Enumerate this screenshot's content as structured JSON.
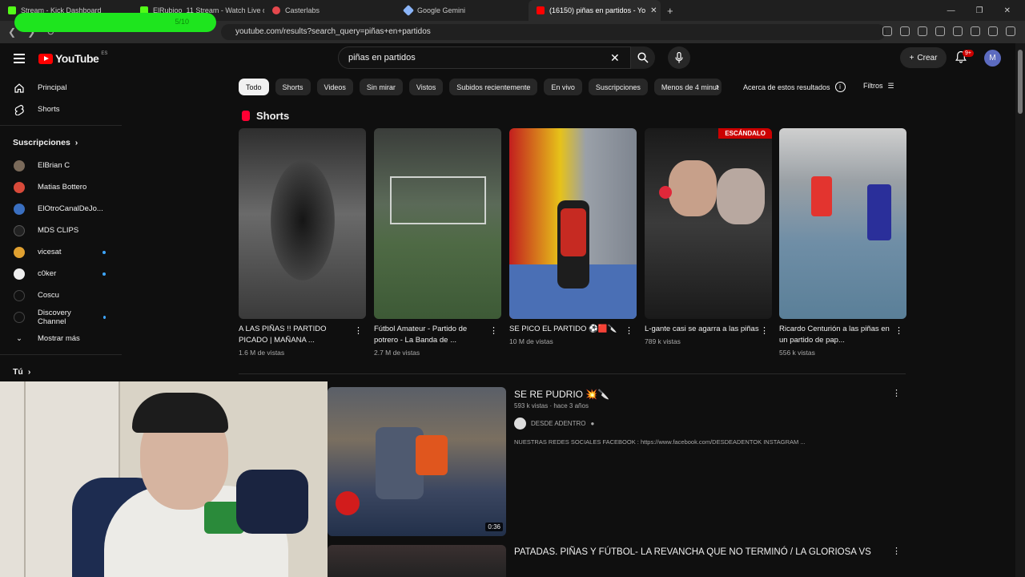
{
  "browser": {
    "tabs": [
      {
        "label": "Stream - Kick Dashboard",
        "color": "#53fc18"
      },
      {
        "label": "ElRubioo_11 Stream - Watch Live on",
        "color": "#53fc18"
      },
      {
        "label": "Casterlabs",
        "color": "#e5484d"
      },
      {
        "label": "Google Gemini",
        "color": "#8ab4f8"
      },
      {
        "label": "(16150) piñas en partidos - Yo",
        "color": "#ff0000"
      }
    ],
    "url": "youtube.com/results?search_query=piñas+en+partidos",
    "progress_text": "5/10",
    "progress_value": 0.5
  },
  "header": {
    "logo_text": "YouTube",
    "logo_country": "ES",
    "search_value": "piñas en partidos",
    "create_label": "Crear",
    "notif_count": "9+",
    "avatar_letter": "M"
  },
  "sidebar": {
    "main": [
      {
        "label": "Principal",
        "icon": "home-icon"
      },
      {
        "label": "Shorts",
        "icon": "shorts-icon"
      }
    ],
    "subs_title": "Suscripciones",
    "subs": [
      {
        "label": "ElBrian C",
        "color": "#7a6a5a",
        "dot": false
      },
      {
        "label": "Matias Bottero",
        "color": "#d84a3a",
        "dot": false
      },
      {
        "label": "ElOtroCanalDeJo...",
        "color": "#3a6fc0",
        "dot": true
      },
      {
        "label": "MDS CLIPS",
        "color": "#222",
        "dot": false
      },
      {
        "label": "vicesat",
        "color": "#e0a030",
        "dot": true
      },
      {
        "label": "c0ker",
        "color": "#eeeeee",
        "dot": true
      },
      {
        "label": "Coscu",
        "color": "#111",
        "dot": false
      },
      {
        "label": "Discovery Channel",
        "color": "#111",
        "dot": true
      }
    ],
    "show_more": "Mostrar más",
    "you": "Tú"
  },
  "chips": [
    "Todo",
    "Shorts",
    "Videos",
    "Sin mirar",
    "Vistos",
    "Subidos recientemente",
    "En vivo",
    "Suscripciones",
    "Menos de 4 minut"
  ],
  "about_label": "Acerca de estos resultados",
  "filters_label": "Filtros",
  "shorts_section": {
    "title": "Shorts",
    "items": [
      {
        "title": "A LAS PIÑAS !! PARTIDO PICADO | MAÑANA ...",
        "views": "1.6 M de vistas"
      },
      {
        "title": "Fútbol Amateur - Partido de potrero - La Banda de ...",
        "views": "2.7 M de vistas"
      },
      {
        "title": "SE PICO EL PARTIDO ⚽🟥🔪",
        "views": "10 M de vistas"
      },
      {
        "title": "L-gante casi se agarra a las piñas",
        "views": "789 k vistas",
        "badge": "ESCÁNDALO"
      },
      {
        "title": "Ricardo Centurión a las piñas en un partido de pap...",
        "views": "556 k vistas"
      }
    ]
  },
  "video1": {
    "title": "SE RE PUDRIO 💥🔪",
    "meta": "593 k vistas · hace 3 años",
    "channel": "DESDE ADENTRO",
    "desc": "NUESTRAS REDES SOCIALES FACEBOOK : https://www.facebook.com/DESDEADENTOK INSTAGRAM ...",
    "duration": "0:36"
  },
  "video2": {
    "title": "PATADAS. PIÑAS Y FÚTBOL- LA REVANCHA QUE NO TERMINÓ / LA GLORIOSA VS"
  }
}
